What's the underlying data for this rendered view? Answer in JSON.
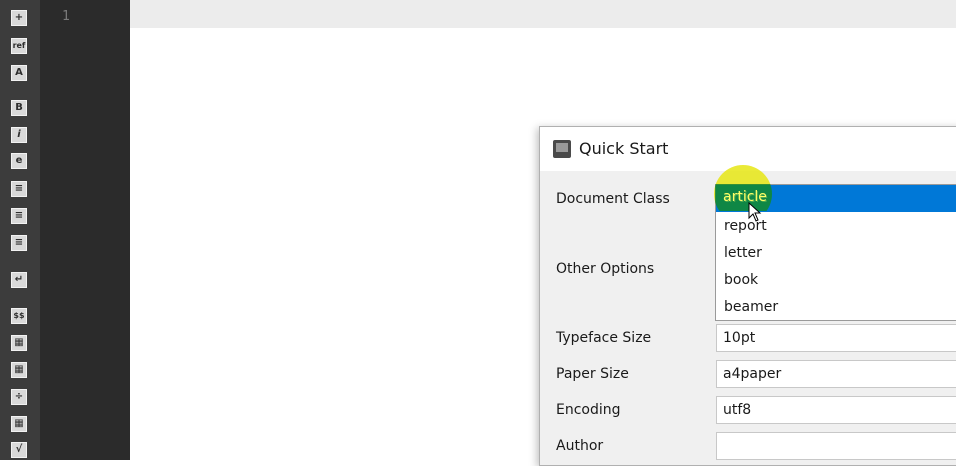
{
  "toolbar": {
    "buttons": [
      {
        "name": "insert-icon",
        "glyph": "+"
      },
      {
        "name": "ref-icon",
        "glyph": "ref"
      },
      {
        "name": "image-icon",
        "glyph": "A"
      },
      {
        "name": "bold-icon",
        "glyph": "B"
      },
      {
        "name": "italic-icon",
        "glyph": "i"
      },
      {
        "name": "emphasis-icon",
        "glyph": "e"
      },
      {
        "name": "align-left-icon",
        "glyph": "≡"
      },
      {
        "name": "align-center-icon",
        "glyph": "≡"
      },
      {
        "name": "align-right-icon",
        "glyph": "≡"
      },
      {
        "name": "newline-icon",
        "glyph": "↵"
      },
      {
        "name": "math-inline-icon",
        "glyph": "$$"
      },
      {
        "name": "matrix-icon",
        "glyph": "▦"
      },
      {
        "name": "subscript-icon",
        "glyph": "▦"
      },
      {
        "name": "fraction-icon",
        "glyph": "÷"
      },
      {
        "name": "table-icon",
        "glyph": "▦"
      },
      {
        "name": "sqrt-icon",
        "glyph": "√"
      }
    ]
  },
  "editor": {
    "line_number": "1"
  },
  "dialog": {
    "title": "Quick Start",
    "labels": {
      "document_class": "Document Class",
      "other_options": "Other Options",
      "typeface_size": "Typeface Size",
      "paper_size": "Paper Size",
      "encoding": "Encoding",
      "author": "Author"
    },
    "fields": {
      "typeface_size": "10pt",
      "paper_size": "a4paper",
      "encoding": "utf8",
      "author": ""
    },
    "document_class_options": [
      "article",
      "report",
      "letter",
      "book",
      "beamer"
    ],
    "selected_option": "article"
  },
  "colors": {
    "selection": "#0078d7",
    "click_highlight": "#e6e614"
  }
}
